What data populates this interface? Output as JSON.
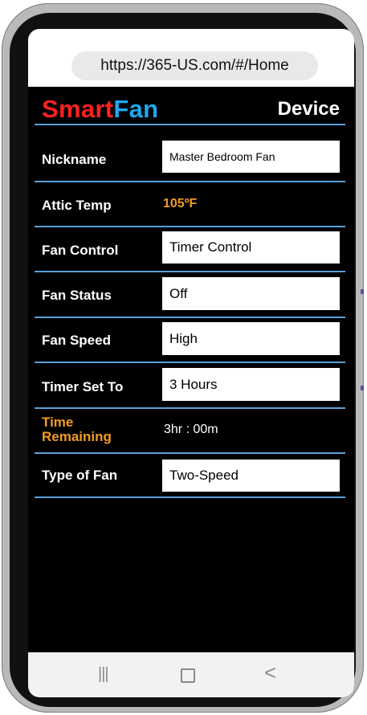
{
  "browser": {
    "url": "https://365-US.com/#/Home"
  },
  "header": {
    "brand_smart": "Smart",
    "brand_fan": "Fan",
    "title": "Device",
    "brand_colors": {
      "smart": "#ff2020",
      "fan": "#20a8f0"
    }
  },
  "rows": {
    "nickname": {
      "label": "Nickname",
      "value": "Master Bedroom Fan"
    },
    "attic_temp": {
      "label": "Attic Temp",
      "value": "105ºF"
    },
    "fan_control": {
      "label": "Fan Control",
      "value": "Timer Control"
    },
    "fan_status": {
      "label": "Fan Status",
      "value": "Off"
    },
    "fan_speed": {
      "label": "Fan Speed",
      "value": "High"
    },
    "timer_set_to": {
      "label": "Timer Set To",
      "value": "3 Hours"
    },
    "time_remaining": {
      "label_line1": "Time",
      "label_line2": "Remaining",
      "value": "3hr : 00m"
    },
    "type_of_fan": {
      "label": "Type of Fan",
      "value": "Two-Speed"
    }
  },
  "navbar": {
    "recents_icon": "recents-icon",
    "home_icon": "home-icon",
    "back_icon": "back-icon"
  }
}
